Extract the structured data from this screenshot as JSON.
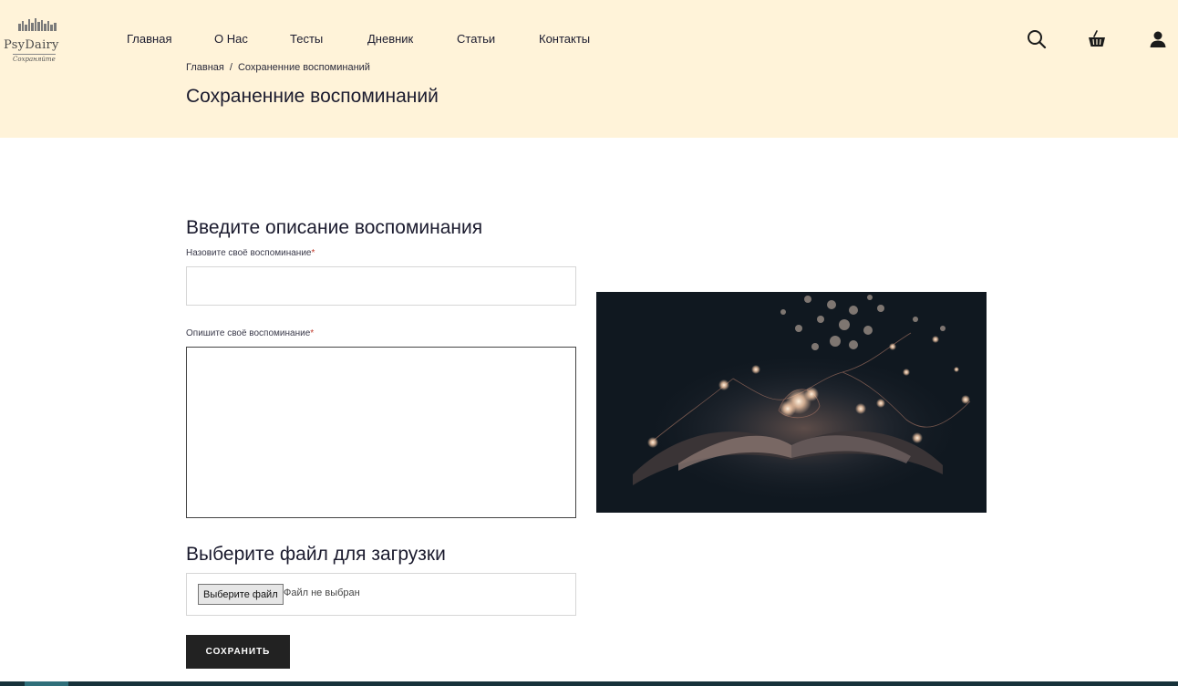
{
  "brand": {
    "name": "PsyDairy",
    "tagline": "Сохраняйте"
  },
  "nav": {
    "items": [
      "Главная",
      "О Нас",
      "Тесты",
      "Дневник",
      "Статьи",
      "Контакты"
    ]
  },
  "header_icons": [
    "search-icon",
    "basket-icon",
    "user-icon"
  ],
  "breadcrumb": {
    "home": "Главная",
    "separator": "/",
    "current": "Сохраненние воспоминаний"
  },
  "page": {
    "title": "Сохраненние воспоминаний"
  },
  "form": {
    "section_title": "Введите описание воспоминания",
    "name_label": "Назовите своё воспоминание",
    "name_value": "",
    "description_label": "Опишите своё воспоминание",
    "description_value": "",
    "required_mark": "*",
    "upload_title": "Выберите файл для загрузки",
    "file_button": "Выберите файл",
    "file_status": "Файл не выбран",
    "submit": "СОХРАНИТЬ"
  },
  "colors": {
    "hero_bg": "#fff3d9",
    "text": "#1b1b2e",
    "button_bg": "#222222",
    "required": "#c0392b",
    "footer": "#17323a"
  }
}
